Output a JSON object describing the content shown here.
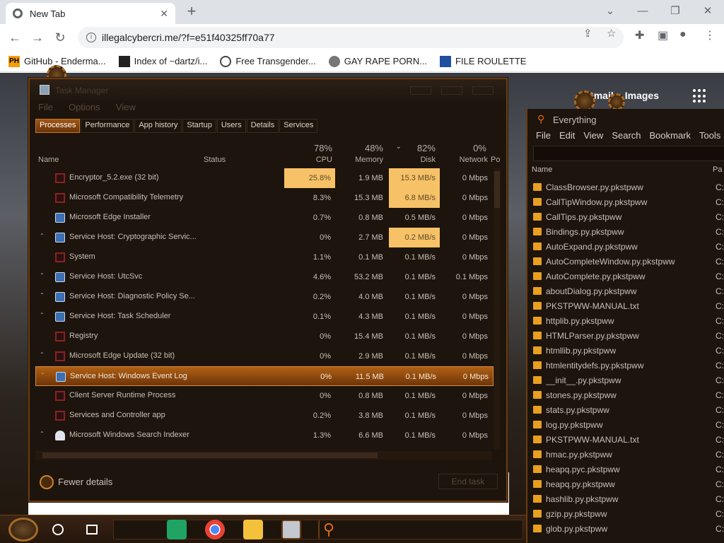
{
  "browser": {
    "tab_title": "New Tab",
    "url": "illegalcybercri.me/?f=e51f40325ff70a77",
    "bookmarks": [
      {
        "icon": "PH",
        "label": "GitHub - Enderma..."
      },
      {
        "icon": "",
        "label": "Index of ~dartz/i..."
      },
      {
        "icon": "",
        "label": "Free Transgender..."
      },
      {
        "icon": "",
        "label": "GAY RAPE PORN..."
      },
      {
        "icon": "",
        "label": "FILE ROULETTE"
      }
    ]
  },
  "google": {
    "gmail": "Gmail",
    "images": "Images"
  },
  "taskmanager": {
    "title": "Task Manager",
    "menu": [
      "File",
      "Options",
      "View"
    ],
    "tabs": [
      "Processes",
      "Performance",
      "App history",
      "Startup",
      "Users",
      "Details",
      "Services"
    ],
    "columns": {
      "name": "Name",
      "status": "Status",
      "cpu": {
        "pct": "78%",
        "label": "CPU"
      },
      "memory": {
        "pct": "48%",
        "label": "Memory"
      },
      "disk": {
        "pct": "82%",
        "label": "Disk"
      },
      "network": {
        "pct": "0%",
        "label": "Network"
      },
      "power": "Po"
    },
    "rows": [
      {
        "name": "Encryptor_5.2.exe (32 bit)",
        "cpu": "25.8%",
        "memory": "1.9 MB",
        "disk": "15.3 MB/s",
        "network": "0 Mbps"
      },
      {
        "name": "Microsoft Compatibility Telemetry",
        "cpu": "8.3%",
        "memory": "15.3 MB",
        "disk": "6.8 MB/s",
        "network": "0 Mbps"
      },
      {
        "name": "Microsoft Edge Installer",
        "cpu": "0.7%",
        "memory": "0.8 MB",
        "disk": "0.5 MB/s",
        "network": "0 Mbps"
      },
      {
        "name": "Service Host: Cryptographic Servic...",
        "cpu": "0%",
        "memory": "2.7 MB",
        "disk": "0.2 MB/s",
        "network": "0 Mbps"
      },
      {
        "name": "System",
        "cpu": "1.1%",
        "memory": "0.1 MB",
        "disk": "0.1 MB/s",
        "network": "0 Mbps"
      },
      {
        "name": "Service Host: UtcSvc",
        "cpu": "4.6%",
        "memory": "53.2 MB",
        "disk": "0.1 MB/s",
        "network": "0.1 Mbps"
      },
      {
        "name": "Service Host: Diagnostic Policy Se...",
        "cpu": "0.2%",
        "memory": "4.0 MB",
        "disk": "0.1 MB/s",
        "network": "0 Mbps"
      },
      {
        "name": "Service Host: Task Scheduler",
        "cpu": "0.1%",
        "memory": "4.3 MB",
        "disk": "0.1 MB/s",
        "network": "0 Mbps"
      },
      {
        "name": "Registry",
        "cpu": "0%",
        "memory": "15.4 MB",
        "disk": "0.1 MB/s",
        "network": "0 Mbps"
      },
      {
        "name": "Microsoft Edge Update (32 bit)",
        "cpu": "0%",
        "memory": "2.9 MB",
        "disk": "0.1 MB/s",
        "network": "0 Mbps"
      },
      {
        "name": "Service Host: Windows Event Log",
        "cpu": "0%",
        "memory": "11.5 MB",
        "disk": "0.1 MB/s",
        "network": "0 Mbps"
      },
      {
        "name": "Client Server Runtime Process",
        "cpu": "0%",
        "memory": "0.8 MB",
        "disk": "0.1 MB/s",
        "network": "0 Mbps"
      },
      {
        "name": "Services and Controller app",
        "cpu": "0.2%",
        "memory": "3.8 MB",
        "disk": "0.1 MB/s",
        "network": "0 Mbps"
      },
      {
        "name": "Microsoft Windows Search Indexer",
        "cpu": "1.3%",
        "memory": "6.6 MB",
        "disk": "0.1 MB/s",
        "network": "0 Mbps"
      }
    ],
    "fewer_details": "Fewer details",
    "end_task": "End task"
  },
  "everything": {
    "title": "Everything",
    "menu": [
      "File",
      "Edit",
      "View",
      "Search",
      "Bookmark",
      "Tools"
    ],
    "col_name": "Name",
    "col_path": "Pa",
    "path_prefix": "C:",
    "files": [
      "ClassBrowser.py.pkstpww",
      "CallTipWindow.py.pkstpww",
      "CallTips.py.pkstpww",
      "Bindings.py.pkstpww",
      "AutoExpand.py.pkstpww",
      "AutoCompleteWindow.py.pkstpww",
      "AutoComplete.py.pkstpww",
      "aboutDialog.py.pkstpww",
      "PKSTPWW-MANUAL.txt",
      "httplib.py.pkstpww",
      "HTMLParser.py.pkstpww",
      "htmllib.py.pkstpww",
      "htmlentitydefs.py.pkstpww",
      "__init__.py.pkstpww",
      "stones.py.pkstpww",
      "stats.py.pkstpww",
      "log.py.pkstpww",
      "PKSTPWW-MANUAL.txt",
      "hmac.py.pkstpww",
      "heapq.pyc.pkstpww",
      "heapq.py.pkstpww",
      "hashlib.py.pkstpww",
      "gzip.py.pkstpww",
      "glob.py.pkstpww"
    ]
  }
}
